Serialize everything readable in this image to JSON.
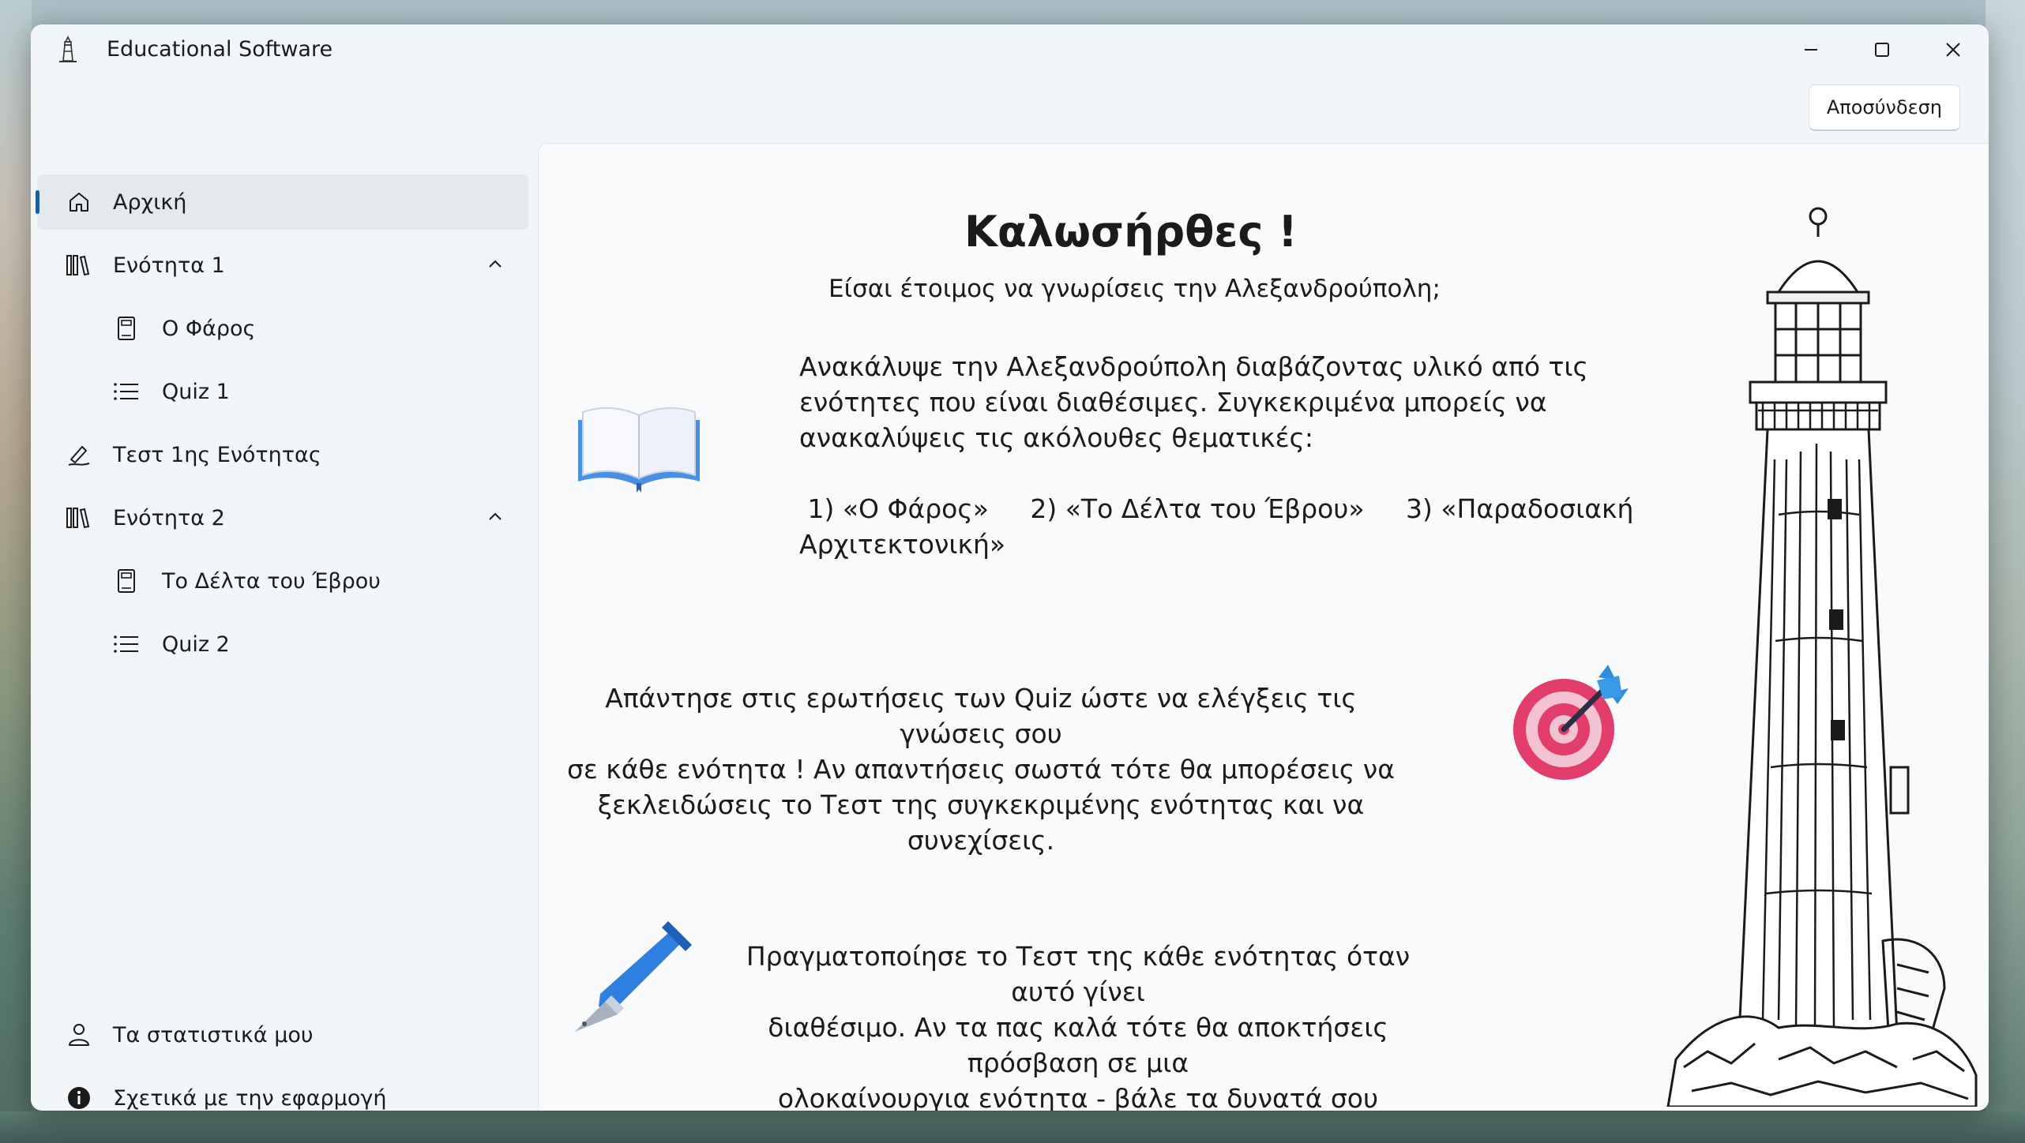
{
  "window": {
    "title": "Educational Software",
    "logout_label": "Αποσύνδεση"
  },
  "nav": {
    "items": [
      {
        "label": "Αρχική",
        "icon": "home-icon",
        "selected": true
      },
      {
        "label": "Ενότητα 1",
        "icon": "library-icon",
        "expanded": true
      },
      {
        "label": "Ο Φάρος",
        "icon": "document-icon"
      },
      {
        "label": "Quiz 1",
        "icon": "list-icon"
      },
      {
        "label": "Τεστ 1ης Ενότητας",
        "icon": "signature-icon"
      },
      {
        "label": "Ενότητα 2",
        "icon": "library-icon",
        "expanded": true
      },
      {
        "label": "Το Δέλτα του Έβρου",
        "icon": "document-icon"
      },
      {
        "label": "Quiz 2",
        "icon": "list-icon"
      }
    ],
    "footer": [
      {
        "label": "Τα στατιστικά μου",
        "icon": "person-icon"
      },
      {
        "label": "Σχετικά με την εφαρμογή",
        "icon": "info-icon"
      }
    ]
  },
  "main": {
    "heading": "Καλωσήρθες !",
    "subtitle": "Είσαι έτοιμος να γνωρίσεις την Αλεξανδρούπολη;",
    "para1": [
      "Ανακάλυψε την Αλεξανδρούπολη διαβάζοντας υλικό από τις",
      "ενότητες που είναι διαθέσιμες. Συγκεκριμένα μπορείς να",
      "ανακαλύψεις τις ακόλουθες θεματικές:"
    ],
    "topics_line1": " 1) «Ο Φάρος»     2) «Το Δέλτα του Έβρου»     3) «Παραδοσιακή",
    "topics_line2": "Αρχιτεκτονική»",
    "para2": [
      "Απάντησε στις ερωτήσεις των Quiz ώστε να ελέγξεις τις γνώσεις σου",
      "σε κάθε ενότητα ! Αν απαντήσεις σωστά τότε θα μπορέσεις να",
      "ξεκλειδώσεις το Τεστ της συγκεκριμένης ενότητας και να συνεχίσεις."
    ],
    "para3": [
      "Πραγματοποίησε το Τεστ της κάθε ενότητας όταν αυτό γίνει",
      "διαθέσιμο. Αν τα πας καλά τότε θα αποκτήσεις πρόσβαση σε μια",
      "ολοκαίνουργια ενότητα - βάλε τα δυνατά σου λοιπόν !"
    ]
  },
  "colors": {
    "accent": "#0067c0",
    "book": "#4a90e2",
    "target": "#e8436d",
    "pen": "#2f7fe0"
  }
}
